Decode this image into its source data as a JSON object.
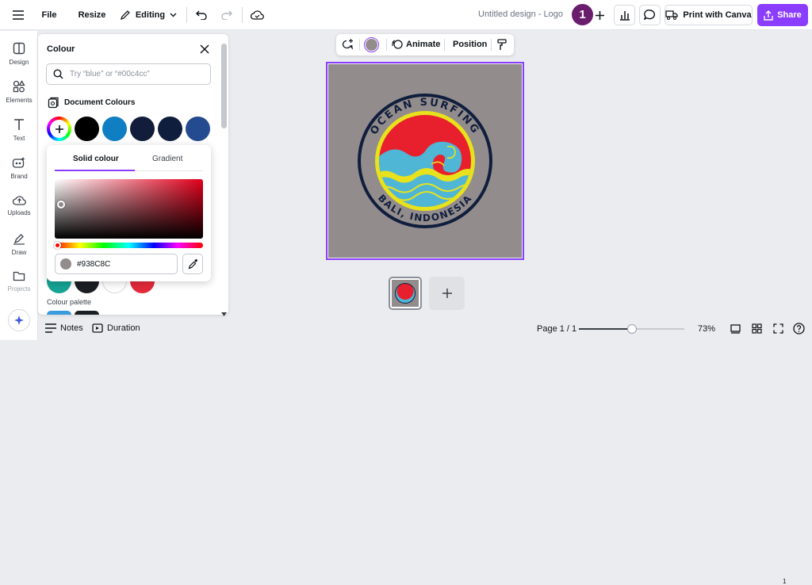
{
  "topbar": {
    "file": "File",
    "resize": "Resize",
    "editing": "Editing",
    "title": "Untitled design - Logo",
    "avatar_initial": "1",
    "print_label": "Print with Canva",
    "share_label": "Share"
  },
  "rail": {
    "items": [
      {
        "label": "Design",
        "icon": "design-icon"
      },
      {
        "label": "Elements",
        "icon": "elements-icon"
      },
      {
        "label": "Text",
        "icon": "text-icon"
      },
      {
        "label": "Brand",
        "icon": "brand-icon"
      },
      {
        "label": "Uploads",
        "icon": "uploads-icon"
      },
      {
        "label": "Draw",
        "icon": "draw-icon"
      },
      {
        "label": "Projects",
        "icon": "projects-icon"
      }
    ]
  },
  "panel": {
    "title": "Colour",
    "search_placeholder": "Try “blue” or “#00c4cc”",
    "doc_colours_label": "Document Colours",
    "doc_colours": [
      "#000000",
      "#0f7ec2",
      "#111d3a",
      "#101e3d",
      "#244a8f"
    ],
    "palette_label": "Colour palette"
  },
  "picker": {
    "tab_solid": "Solid colour",
    "tab_gradient": "Gradient",
    "hex": "#938C8C",
    "hex_color": "#938c8c"
  },
  "floatbar": {
    "animate": "Animate",
    "position": "Position",
    "swatch_color": "#938c8c"
  },
  "logo": {
    "top_text": "OCEAN SURFING",
    "bottom_text": "BALI, INDONESIA"
  },
  "pages": {
    "thumb_number": "1"
  },
  "bottombar": {
    "notes": "Notes",
    "duration": "Duration",
    "page": "Page 1 / 1",
    "zoom": "73%"
  },
  "colors": {
    "accent": "#8b3dff",
    "canvas_bg": "#938c8c"
  }
}
